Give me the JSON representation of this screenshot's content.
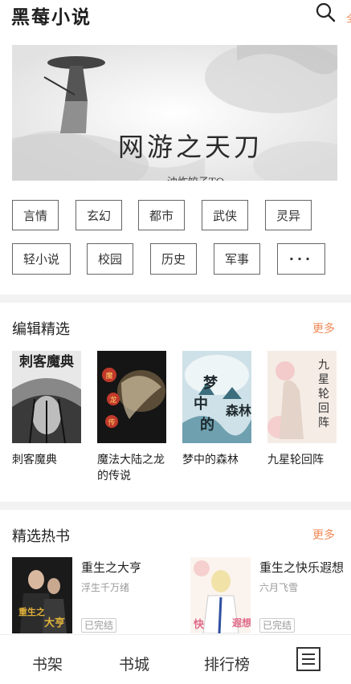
{
  "header": {
    "app_title": "黑莓小说",
    "edge_text": "全"
  },
  "banner": {
    "title": "网游之天刀",
    "author": "油炸饺子TO",
    "slides": 2,
    "active_slide": 0
  },
  "categories": [
    "言情",
    "玄幻",
    "都市",
    "武侠",
    "灵异",
    "轻小说",
    "校园",
    "历史",
    "军事",
    "···"
  ],
  "editor_picks": {
    "title": "编辑精选",
    "more": "更多",
    "books": [
      {
        "name": "刺客魔典",
        "cover_text": "刺客魔典"
      },
      {
        "name": "魔法大陆之龙的传说",
        "cover_text": "魔法大陆之龙的传说"
      },
      {
        "name": "梦中的森林",
        "cover_text": "梦中的森林"
      },
      {
        "name": "九星轮回阵",
        "cover_text": "九星轮回阵"
      }
    ]
  },
  "hot_picks": {
    "title": "精选热书",
    "more": "更多",
    "books": [
      {
        "title": "重生之大亨",
        "author": "浮生千万绪",
        "status": "已完结",
        "cover_text": "重生之大亨"
      },
      {
        "title": "重生之快乐遐想",
        "author": "六月飞雪",
        "status": "已完结",
        "cover_text": "快乐遐想"
      }
    ]
  },
  "bottom_nav": {
    "items": [
      "书架",
      "书城",
      "排行榜"
    ],
    "active": "书城"
  },
  "colors": {
    "accent": "#f08a56",
    "text": "#222222",
    "muted": "#999999"
  }
}
